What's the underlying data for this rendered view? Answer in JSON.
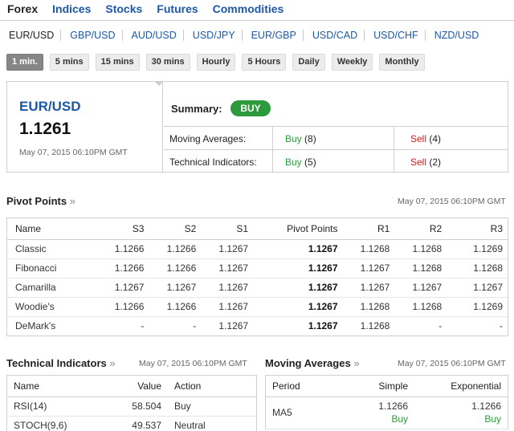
{
  "top_tabs": [
    "Forex",
    "Indices",
    "Stocks",
    "Futures",
    "Commodities"
  ],
  "pairs": [
    "EUR/USD",
    "GBP/USD",
    "AUD/USD",
    "USD/JPY",
    "EUR/GBP",
    "USD/CAD",
    "USD/CHF",
    "NZD/USD"
  ],
  "periods": [
    "1 min.",
    "5 mins",
    "15 mins",
    "30 mins",
    "Hourly",
    "5 Hours",
    "Daily",
    "Weekly",
    "Monthly"
  ],
  "summary": {
    "pair": "EUR/USD",
    "price": "1.1261",
    "time": "May 07, 2015 06:10PM GMT",
    "title": "Summary:",
    "badge": "BUY",
    "rows": [
      {
        "label": "Moving Averages:",
        "buy": "Buy",
        "buy_count": "(8)",
        "sell": "Sell",
        "sell_count": "(4)"
      },
      {
        "label": "Technical Indicators:",
        "buy": "Buy",
        "buy_count": "(5)",
        "sell": "Sell",
        "sell_count": "(2)"
      }
    ]
  },
  "pivot": {
    "title": "Pivot Points",
    "time": "May 07, 2015 06:10PM GMT",
    "headers": [
      "Name",
      "S3",
      "S2",
      "S1",
      "Pivot Points",
      "R1",
      "R2",
      "R3"
    ],
    "rows": [
      [
        "Classic",
        "1.1266",
        "1.1266",
        "1.1267",
        "1.1267",
        "1.1268",
        "1.1268",
        "1.1269"
      ],
      [
        "Fibonacci",
        "1.1266",
        "1.1266",
        "1.1267",
        "1.1267",
        "1.1267",
        "1.1268",
        "1.1268"
      ],
      [
        "Camarilla",
        "1.1267",
        "1.1267",
        "1.1267",
        "1.1267",
        "1.1267",
        "1.1267",
        "1.1267"
      ],
      [
        "Woodie's",
        "1.1266",
        "1.1266",
        "1.1267",
        "1.1267",
        "1.1268",
        "1.1268",
        "1.1269"
      ],
      [
        "DeMark's",
        "-",
        "-",
        "1.1267",
        "1.1267",
        "1.1268",
        "-",
        "-"
      ]
    ]
  },
  "technical": {
    "title": "Technical Indicators",
    "time": "May 07, 2015 06:10PM GMT",
    "headers": [
      "Name",
      "Value",
      "Action"
    ],
    "rows": [
      {
        "name": "RSI(14)",
        "value": "58.504",
        "action": "Buy"
      },
      {
        "name": "STOCH(9,6)",
        "value": "49.537",
        "action": "Neutral"
      }
    ]
  },
  "moving": {
    "title": "Moving Averages",
    "time": "May 07, 2015 06:10PM GMT",
    "headers": [
      "Period",
      "Simple",
      "Exponential"
    ],
    "rows": [
      {
        "period": "MA5",
        "simple_value": "1.1266",
        "simple_action": "Buy",
        "exp_value": "1.1266",
        "exp_action": "Buy"
      }
    ]
  },
  "raquo": "»",
  "colors": {
    "link": "#1d58a8",
    "buy": "#2d9a3b",
    "sell": "#d21b1b"
  }
}
